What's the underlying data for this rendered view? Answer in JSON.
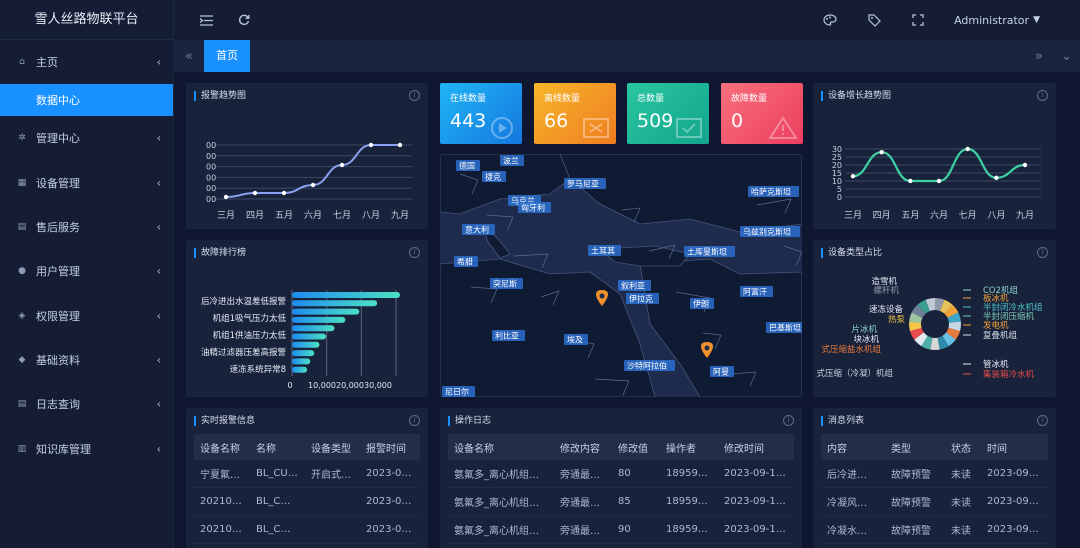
{
  "app": {
    "title": "雪人丝路物联平台"
  },
  "sidebar": {
    "items": [
      {
        "label": "主页",
        "icon": "home-icon"
      },
      {
        "label": "数据中心",
        "active": true
      },
      {
        "label": "管理中心",
        "icon": "gear-icon"
      },
      {
        "label": "设备管理",
        "icon": "device-icon"
      },
      {
        "label": "售后服务",
        "icon": "service-icon"
      },
      {
        "label": "用户管理",
        "icon": "user-icon"
      },
      {
        "label": "权限管理",
        "icon": "shield-icon"
      },
      {
        "label": "基础资料",
        "icon": "cube-icon"
      },
      {
        "label": "日志查询",
        "icon": "log-icon"
      },
      {
        "label": "知识库管理",
        "icon": "book-icon"
      }
    ]
  },
  "header": {
    "user": "Administrator"
  },
  "tabs": {
    "home": "首页"
  },
  "colors": {
    "accent": "#1890ff",
    "online": "#1a9cf0",
    "offline": "#f2a31f",
    "total": "#21b99c",
    "fault": "#f0516c",
    "line": "#8aa0f0",
    "growth": "#3fd1a6"
  },
  "stats": [
    {
      "label": "在线数量",
      "value": "443"
    },
    {
      "label": "离线数量",
      "value": "66"
    },
    {
      "label": "总数量",
      "value": "509"
    },
    {
      "label": "故障数量",
      "value": "0"
    }
  ],
  "panels": {
    "alarm_trend": "报警趋势图",
    "fault_rank": "故障排行榜",
    "growth_trend": "设备增长趋势图",
    "type_share": "设备类型占比",
    "realtime": "实时报警信息",
    "oplog": "操作日志",
    "messages": "消息列表"
  },
  "chart_data": [
    {
      "type": "line",
      "title": "报警趋势图",
      "categories": [
        "三月",
        "四月",
        "五月",
        "六月",
        "七月",
        "八月",
        "九月"
      ],
      "values": [
        1,
        2,
        2,
        4,
        9,
        14,
        14
      ],
      "y_tick_labels": [
        "00",
        "00",
        "00",
        "00",
        "00",
        "00"
      ]
    },
    {
      "type": "bar",
      "title": "故障排行榜",
      "orientation": "horizontal",
      "categories": [
        "后冷进出水温差低报警",
        "机组1吸气压力太低",
        "机组1供油压力太低",
        "油精过滤器压差高报警",
        "速冻系统异常8"
      ],
      "x_tick_labels": [
        "0",
        "10,000",
        "20,000",
        "30,000"
      ]
    },
    {
      "type": "line",
      "title": "设备增长趋势图",
      "categories": [
        "三月",
        "四月",
        "五月",
        "六月",
        "七月",
        "八月",
        "九月"
      ],
      "values": [
        13,
        28,
        10,
        10,
        30,
        12,
        20
      ],
      "ylim": [
        0,
        30
      ],
      "yticks": [
        0,
        5,
        10,
        15,
        20,
        25,
        30
      ]
    },
    {
      "type": "pie",
      "title": "设备类型占比",
      "labels": [
        "CO2机组",
        "板冰机",
        "半封闭冷水机组",
        "半封闭压缩机",
        "发电机",
        "复叠机组",
        "管冰机",
        "集装箱冷水机",
        "冷水机组",
        "块冰机",
        "片冰机",
        "速冻设备",
        "热泵",
        "螺杆机",
        "造雪机",
        "式压缩盐水机组",
        "式压缩（冷凝）机组"
      ]
    }
  ],
  "map": {
    "labels": [
      "德国",
      "波兰",
      "捷克",
      "乌克兰",
      "匈牙利",
      "罗马尼亚",
      "哈萨克斯坦",
      "意大利",
      "乌兹别克斯坦",
      "土耳其",
      "土库曼斯坦",
      "希腊",
      "叙利亚",
      "伊拉克",
      "伊朗",
      "阿富汗",
      "巴基斯坦",
      "利比亚",
      "埃及",
      "沙特阿拉伯",
      "阿曼",
      "尼日尔",
      "突尼斯"
    ]
  },
  "realtime_table": {
    "headers": [
      "设备名称",
      "名称",
      "设备类型",
      "报警时间"
    ],
    "rows": [
      [
        "宁夏氟…",
        "BL_CU…",
        "开启式…",
        "2023-0…"
      ],
      [
        "20210…",
        "BL_C…",
        "",
        "2023-0…"
      ],
      [
        "20210…",
        "BL_C…",
        "",
        "2023-0…"
      ]
    ]
  },
  "oplog_table": {
    "headers": [
      "设备名称",
      "修改内容",
      "修改值",
      "操作者",
      "修改时间"
    ],
    "rows": [
      [
        "氨氟多_离心机组…",
        "旁通最…",
        "80",
        "18959…",
        "2023-09-1…"
      ],
      [
        "氨氟多_离心机组…",
        "旁通最…",
        "85",
        "18959…",
        "2023-09-1…"
      ],
      [
        "氨氟多_离心机组…",
        "旁通最…",
        "90",
        "18959…",
        "2023-09-1…"
      ]
    ]
  },
  "message_table": {
    "headers": [
      "内容",
      "类型",
      "状态",
      "时间"
    ],
    "rows": [
      [
        "后冷进…",
        "故障预警",
        "未读",
        "2023-09…"
      ],
      [
        "冷凝风…",
        "故障预警",
        "未读",
        "2023-09…"
      ],
      [
        "冷凝水…",
        "故障预警",
        "未读",
        "2023-09…"
      ]
    ]
  }
}
